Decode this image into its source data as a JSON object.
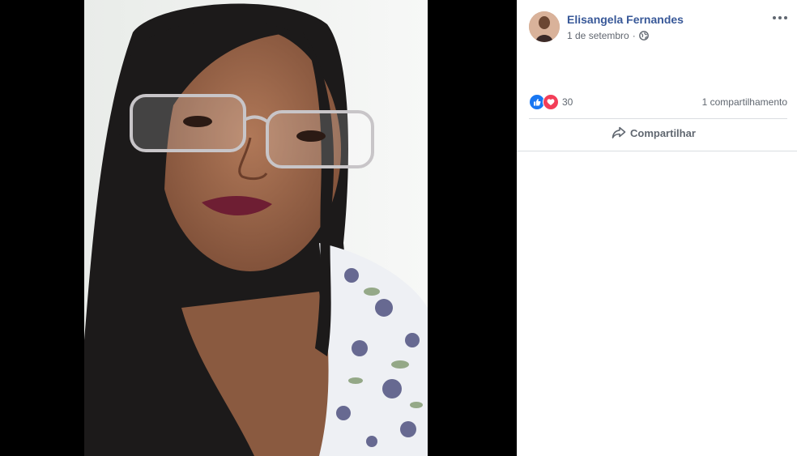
{
  "post": {
    "author": "Elisangela Fernandes",
    "date": "1 de setembro",
    "separator": "·",
    "privacy_icon": "globe-icon",
    "options_icon": "ellipsis-icon"
  },
  "reactions": {
    "icons": [
      "like-icon",
      "love-icon"
    ],
    "count": "30",
    "shares": "1 compartilhamento"
  },
  "actions": {
    "share_label": "Compartilhar",
    "share_icon": "share-arrow-icon"
  },
  "colors": {
    "link": "#385898",
    "like": "#1877f2",
    "love": "#f33e58",
    "secondary_text": "#606770"
  }
}
